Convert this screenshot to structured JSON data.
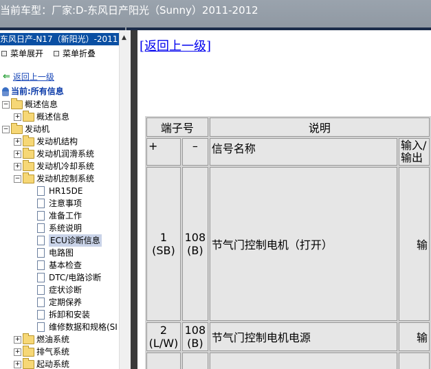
{
  "title_bar": {
    "text": "当前车型：厂家:D-东风日产阳光（Sunny）2011-2012"
  },
  "tree": {
    "header": "东风日产-N17（新阳光）-2011",
    "expand_label": "菜单展开",
    "collapse_label": "菜单折叠",
    "back_label": "返回上一级",
    "current_label": "当前:所有信息",
    "nodes": [
      {
        "label": "概述信息"
      },
      {
        "label": "概述信息"
      },
      {
        "label": "发动机"
      },
      {
        "label": "发动机结构"
      },
      {
        "label": "发动机润滑系统"
      },
      {
        "label": "发动机冷却系统"
      },
      {
        "label": "发动机控制系统"
      },
      {
        "label": "HR15DE"
      },
      {
        "label": "注意事项"
      },
      {
        "label": "准备工作"
      },
      {
        "label": "系统说明"
      },
      {
        "label": "ECU诊断信息"
      },
      {
        "label": "电路图"
      },
      {
        "label": "基本检查"
      },
      {
        "label": "DTC/电路诊断"
      },
      {
        "label": "症状诊断"
      },
      {
        "label": "定期保养"
      },
      {
        "label": "拆卸和安装"
      },
      {
        "label": "维修数据和规格(SI"
      },
      {
        "label": "燃油系统"
      },
      {
        "label": "排气系统"
      },
      {
        "label": "起动系统"
      }
    ]
  },
  "content": {
    "back_link": "[返回上一级]",
    "table": {
      "header": {
        "terminal": "端子号",
        "description": "说明"
      },
      "subheader": {
        "plus": "+",
        "minus": "–",
        "signal_name": "信号名称",
        "io": "输入/输出"
      },
      "rows": [
        {
          "plus": "1 (SB)",
          "minus": "108 (B)",
          "signal": "节气门控制电机（打开）",
          "io": "输"
        },
        {
          "plus": "2 (L/W)",
          "minus": "108 (B)",
          "signal": "节气门控制电机电源",
          "io": "输"
        }
      ]
    }
  }
}
